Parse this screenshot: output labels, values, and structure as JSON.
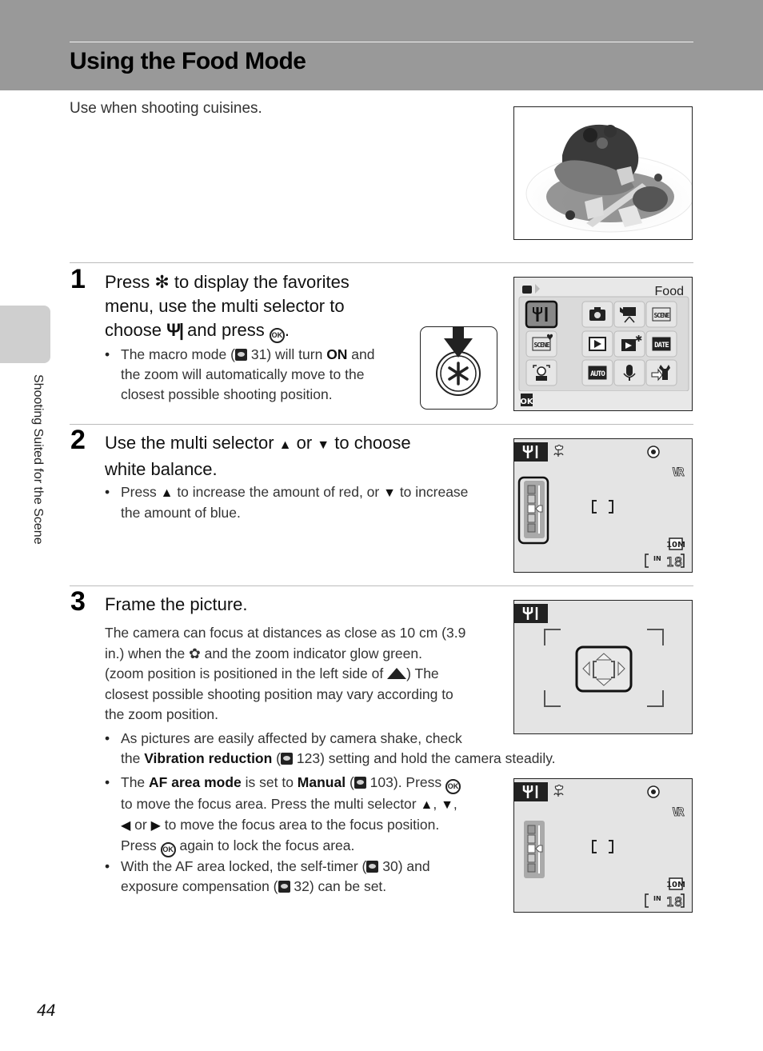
{
  "header": {
    "title": "Using the Food Mode"
  },
  "intro": "Use when shooting cuisines.",
  "side": {
    "chapter": "Shooting Suited for the Scene"
  },
  "step1": {
    "number": "1",
    "head_a": "Press ",
    "head_b": " to display the favorites",
    "head_c": "menu, use the multi selector to",
    "head_d": "choose ",
    "head_e": " and press ",
    "head_f": ".",
    "bullet_a": "The macro mode (",
    "bullet_ref": "31",
    "bullet_b": ") will turn ",
    "bullet_on": "ON",
    "bullet_c": " and",
    "bullet_line2": "the zoom will automatically move to the",
    "bullet_line3": "closest possible shooting position."
  },
  "menu_screen": {
    "title": "Food",
    "ok_label": "OK",
    "icons": [
      "food-icon",
      "camera-icon",
      "movie-icon",
      "scene-icon",
      "scene-favorite-icon",
      "playback-icon",
      "blog-icon",
      "date-icon",
      "portrait-icon",
      "auto-icon",
      "voice-icon",
      "setup-icon"
    ],
    "labels": {
      "scene": "SCENE",
      "date": "DATE",
      "auto": "AUTO"
    }
  },
  "step2": {
    "number": "2",
    "head_a": "Use the multi selector ",
    "head_b": " or  ",
    "head_c": " to choose",
    "head_d": "white balance.",
    "bullet_a": "Press ",
    "bullet_b": " to increase the amount of red, or ",
    "bullet_c": " to increase",
    "bullet_d": "the amount of blue."
  },
  "lcd": {
    "vr": "VR",
    "size": "10M",
    "memory": "IN",
    "shots": "18",
    "white_balance_level": 3,
    "white_balance_steps": 5
  },
  "step3": {
    "number": "3",
    "head": "Frame the picture.",
    "para_1": "The camera can focus at distances as close as 10 cm (3.9",
    "para_2a": "in.) when the ",
    "para_2b": " and the zoom indicator glow green.",
    "para_3a": "(zoom position is positioned in the left side of ",
    "para_3b": ") The",
    "para_4": "closest possible shooting position may vary according to",
    "para_5": "the zoom position.",
    "b1_a": "As pictures are easily affected by camera shake, check",
    "b1_b": "the ",
    "b1_bold": "Vibration reduction",
    "b1_c": " (",
    "b1_ref": "123",
    "b1_d": ") setting and hold the camera steadily.",
    "b2_a": "The ",
    "b2_bold1": "AF area mode",
    "b2_b": " is set to ",
    "b2_bold2": "Manual",
    "b2_c": " (",
    "b2_ref": "103",
    "b2_d": "). Press ",
    "b2_line2a": "to move the focus area. Press the multi selector ",
    "b2_line2b": ", ",
    "b2_line2c": ",",
    "b2_line3a": " or ",
    "b2_line3b": " to move the focus area to the focus position.",
    "b2_line4a": "Press ",
    "b2_line4b": " again to lock the focus area.",
    "b3_a": "With the AF area locked, the self-timer (",
    "b3_ref1": "30",
    "b3_b": ") and",
    "b3_c": "exposure compensation (",
    "b3_ref2": "32",
    "b3_d": ") can be set."
  },
  "glyphs": {
    "up": "▲",
    "down": "▼",
    "left": "◀",
    "right": "▶",
    "ok": "OK",
    "star": "✻"
  },
  "footer": {
    "page_number": "44"
  }
}
